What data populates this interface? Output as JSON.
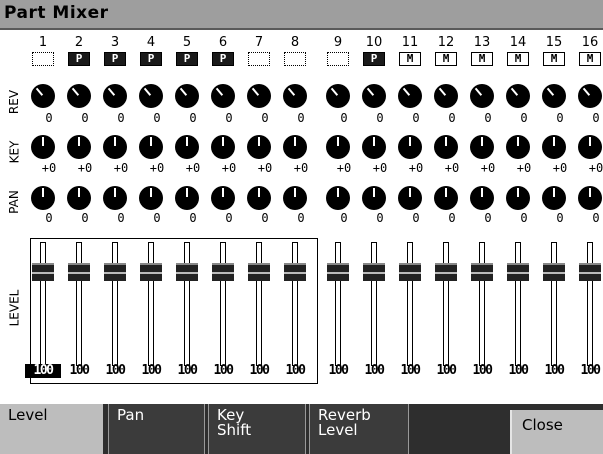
{
  "title": "Part Mixer",
  "row_labels": {
    "rev": "REV",
    "key": "KEY",
    "pan": "PAN",
    "level": "LEVEL"
  },
  "parts": [
    {
      "num": "1",
      "badge": "",
      "rev": "0",
      "key": "+0",
      "pan": "0",
      "level": "100",
      "selected": true
    },
    {
      "num": "2",
      "badge": "P",
      "rev": "0",
      "key": "+0",
      "pan": "0",
      "level": "100"
    },
    {
      "num": "3",
      "badge": "P",
      "rev": "0",
      "key": "+0",
      "pan": "0",
      "level": "100"
    },
    {
      "num": "4",
      "badge": "P",
      "rev": "0",
      "key": "+0",
      "pan": "0",
      "level": "100"
    },
    {
      "num": "5",
      "badge": "P",
      "rev": "0",
      "key": "+0",
      "pan": "0",
      "level": "100"
    },
    {
      "num": "6",
      "badge": "P",
      "rev": "0",
      "key": "+0",
      "pan": "0",
      "level": "100"
    },
    {
      "num": "7",
      "badge": "",
      "rev": "0",
      "key": "+0",
      "pan": "0",
      "level": "100"
    },
    {
      "num": "8",
      "badge": "",
      "rev": "0",
      "key": "+0",
      "pan": "0",
      "level": "100"
    },
    {
      "num": "9",
      "badge": "",
      "rev": "0",
      "key": "+0",
      "pan": "0",
      "level": "100"
    },
    {
      "num": "10",
      "badge": "P",
      "rev": "0",
      "key": "+0",
      "pan": "0",
      "level": "100"
    },
    {
      "num": "11",
      "badge": "M",
      "rev": "0",
      "key": "+0",
      "pan": "0",
      "level": "100"
    },
    {
      "num": "12",
      "badge": "M",
      "rev": "0",
      "key": "+0",
      "pan": "0",
      "level": "100"
    },
    {
      "num": "13",
      "badge": "M",
      "rev": "0",
      "key": "+0",
      "pan": "0",
      "level": "100"
    },
    {
      "num": "14",
      "badge": "M",
      "rev": "0",
      "key": "+0",
      "pan": "0",
      "level": "100"
    },
    {
      "num": "15",
      "badge": "M",
      "rev": "0",
      "key": "+0",
      "pan": "0",
      "level": "100"
    },
    {
      "num": "16",
      "badge": "M",
      "rev": "0",
      "key": "+0",
      "pan": "0",
      "level": "100"
    }
  ],
  "tabs": [
    {
      "label": "Level",
      "active": true
    },
    {
      "label": "Pan",
      "active": false
    },
    {
      "label": "Key\nShift",
      "active": false
    },
    {
      "label": "Reverb\nLevel",
      "active": false
    }
  ],
  "close_label": "Close"
}
